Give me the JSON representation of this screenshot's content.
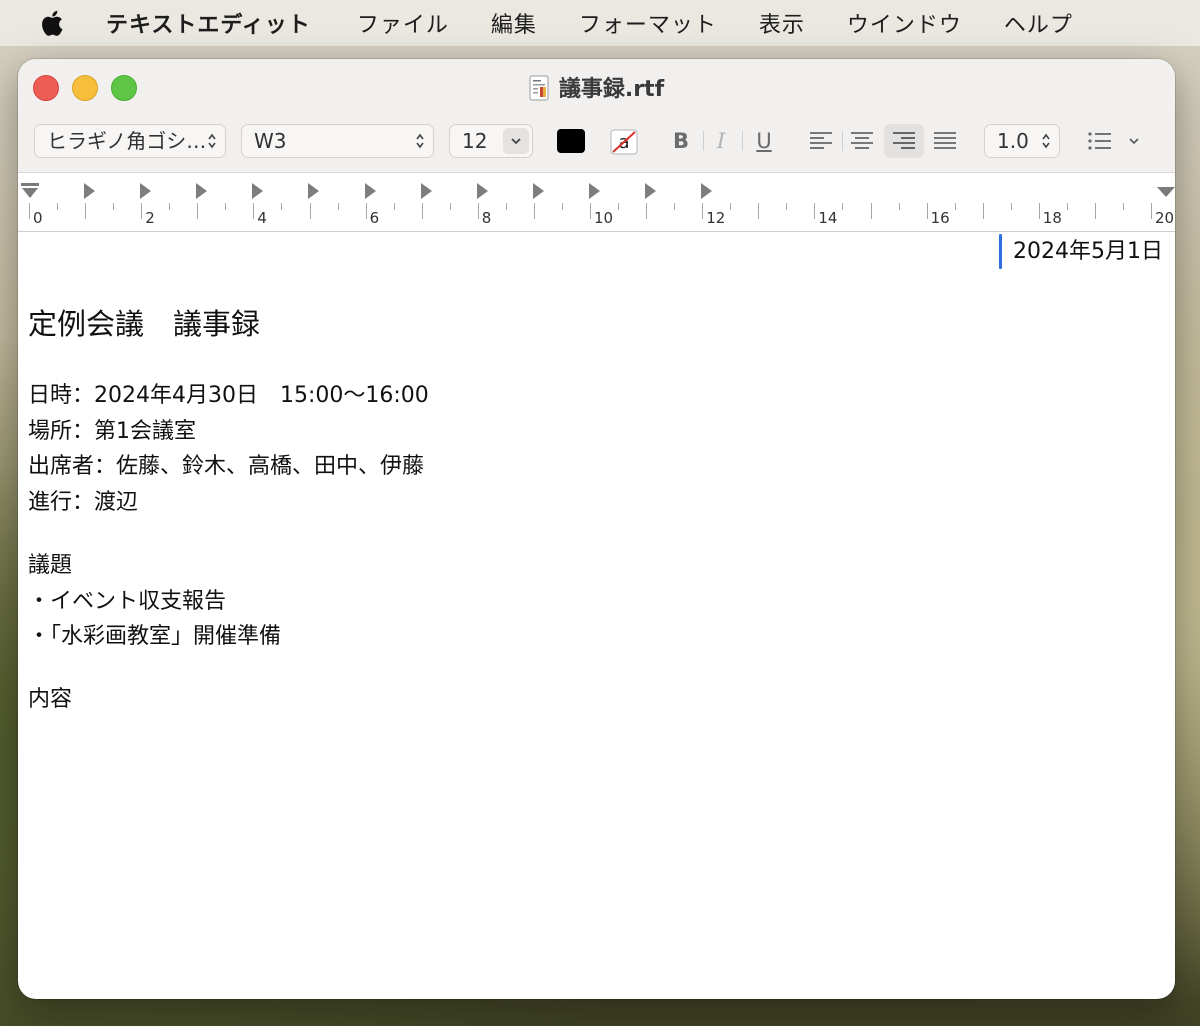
{
  "menubar": {
    "app_name": "テキストエディット",
    "items": [
      "ファイル",
      "編集",
      "フォーマット",
      "表示",
      "ウインドウ",
      "ヘルプ"
    ]
  },
  "window": {
    "title": "議事録.rtf"
  },
  "toolbar": {
    "font_family": "ヒラギノ角ゴシ…",
    "font_weight": "W3",
    "font_size": "12",
    "text_color": "#000000",
    "bold_label": "B",
    "italic_label": "I",
    "underline_label": "U",
    "line_spacing": "1.0",
    "alignment_selected": "right"
  },
  "ruler": {
    "labels": [
      "0",
      "2",
      "4",
      "6",
      "8",
      "10",
      "12",
      "14",
      "16",
      "18",
      "20"
    ]
  },
  "document": {
    "date": "2024年5月1日",
    "heading": "定例会議　議事録",
    "datetime_line": "日時：2024年4月30日　15:00〜16:00",
    "place_line": "場所：第1会議室",
    "attendees_line": "出席者：佐藤、鈴木、高橋、田中、伊藤",
    "facilitator_line": "進行：渡辺",
    "agenda_heading": "議題",
    "agenda_items": [
      "・イベント収支報告",
      "・「水彩画教室」開催準備"
    ],
    "content_heading": "内容"
  }
}
